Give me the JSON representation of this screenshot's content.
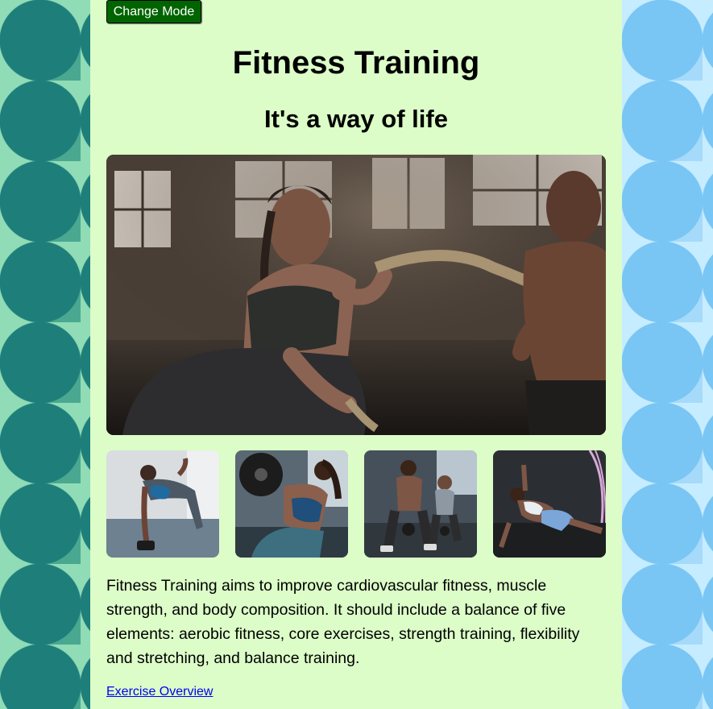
{
  "button": {
    "label": "Change Mode"
  },
  "header": {
    "title": "Fitness Training",
    "subtitle": "It's a way of life"
  },
  "hero_image": {
    "name": "woman-battle-ropes-photo"
  },
  "thumbnails": [
    {
      "name": "side-plank-dumbbell-photo"
    },
    {
      "name": "barbell-lunge-photo"
    },
    {
      "name": "kettlebell-swing-photo"
    },
    {
      "name": "side-plank-reach-photo"
    }
  ],
  "body": {
    "paragraph": "Fitness Training aims to improve cardiovascular fitness, muscle strength, and body composition. It should include a balance of five elements: aerobic fitness, core exercises, strength training, flexibility and stretching, and balance training."
  },
  "link": {
    "label": "Exercise Overview"
  },
  "colors": {
    "content_bg": "#dcfcc8",
    "button_bg": "#006400",
    "left_pattern": "#1e7e7a",
    "right_pattern": "#79c5f4",
    "link": "#0000ee"
  }
}
